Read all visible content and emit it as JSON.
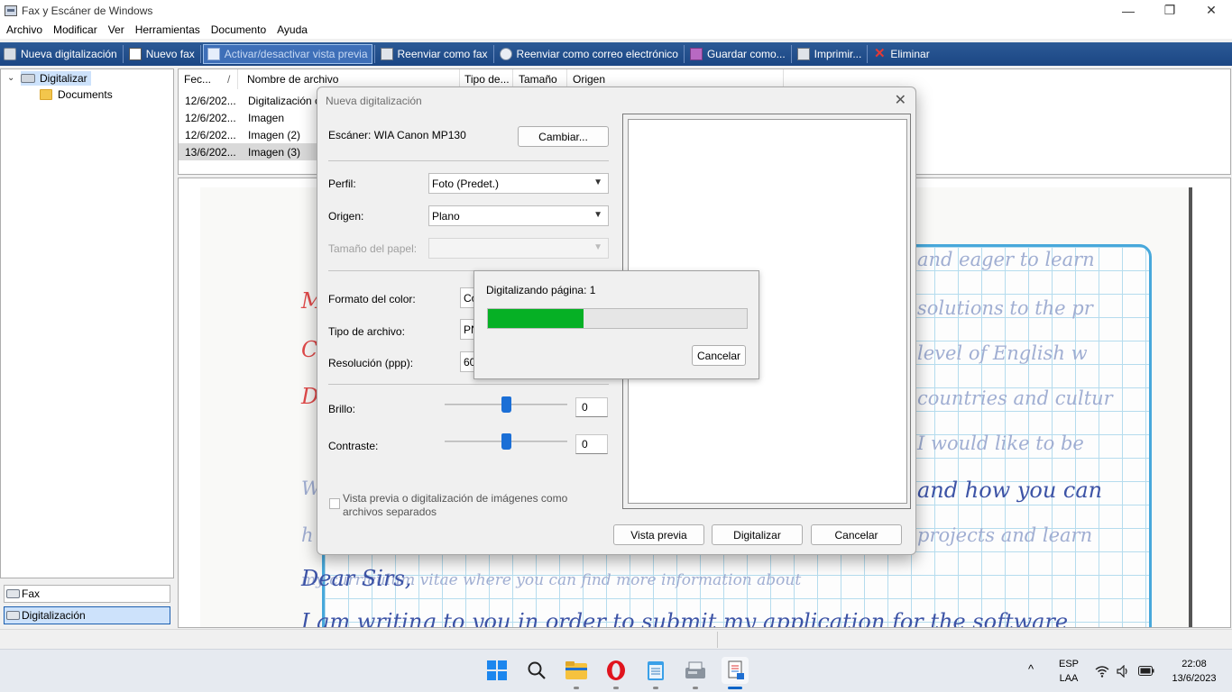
{
  "window": {
    "title": "Fax y Escáner de Windows",
    "controls": {
      "minimize": "—",
      "maximize": "❐",
      "close": "✕"
    }
  },
  "menu": [
    "Archivo",
    "Modificar",
    "Ver",
    "Herramientas",
    "Documento",
    "Ayuda"
  ],
  "toolbar": {
    "new_scan": "Nueva digitalización",
    "new_fax": "Nuevo fax",
    "toggle_preview": "Activar/desactivar vista previa",
    "forward_fax": "Reenviar como fax",
    "forward_email": "Reenviar como correo electrónico",
    "save_as": "Guardar como...",
    "print": "Imprimir...",
    "delete": "Eliminar"
  },
  "tree": {
    "root": "Digitalizar",
    "child": "Documents"
  },
  "nav": {
    "fax": "Fax",
    "scan": "Digitalización"
  },
  "list": {
    "headers": {
      "date": "Fec...",
      "sort": "/",
      "name": "Nombre de archivo",
      "type": "Tipo de...",
      "size": "Tamaño",
      "origin": "Origen"
    },
    "rows": [
      {
        "date": "12/6/202...",
        "name": "Digitalización c"
      },
      {
        "date": "12/6/202...",
        "name": "Imagen"
      },
      {
        "date": "12/6/202...",
        "name": "Imagen (2)"
      },
      {
        "date": "13/6/202...",
        "name": "Imagen (3)"
      }
    ]
  },
  "preview_text": {
    "l1": "and eager to learn",
    "l2": "solutions to the pr",
    "l3": "level of English w",
    "l4": "countries and cultur",
    "l5": "I would like to be",
    "l6": "and how you can",
    "l7": "projects and learn",
    "l8": "my curriculum vitae where you can find more information about",
    "l9": "Dear Sirs,",
    "l10": "I am writing to you in order to submit my application for the software",
    "lw": "W",
    "lh": "h",
    "lu": "u",
    "red_m": "M",
    "red_c": "C",
    "red_d": "D"
  },
  "dialog": {
    "title": "Nueva digitalización",
    "scanner_label": "Escáner: WIA Canon MP130",
    "change_button": "Cambiar...",
    "profile_label": "Perfil:",
    "profile_value": "Foto (Predet.)",
    "source_label": "Origen:",
    "source_value": "Plano",
    "paper_size_label": "Tamaño del papel:",
    "color_format_label": "Formato del color:",
    "color_format_value": "Co",
    "file_type_label": "Tipo de archivo:",
    "file_type_value": "PN",
    "resolution_label": "Resolución (ppp):",
    "resolution_value": "60",
    "brightness_label": "Brillo:",
    "brightness_value": "0",
    "contrast_label": "Contraste:",
    "contrast_value": "0",
    "separate_files_line1": "Vista previa o digitalización de imágenes como",
    "separate_files_line2": "archivos separados",
    "preview_button": "Vista previa",
    "scan_button": "Digitalizar",
    "cancel_button": "Cancelar"
  },
  "progress": {
    "text": "Digitalizando página: 1",
    "fraction": 0.37,
    "cancel_button": "Cancelar"
  },
  "tray": {
    "lang1": "ESP",
    "lang2": "LAA",
    "time": "22:08",
    "date": "13/6/2023",
    "chevron": "^"
  },
  "colors": {
    "toolbar": "#1b4684",
    "progress": "#06b025",
    "slider": "#1b6fd6",
    "grid_border": "#47a8db"
  }
}
